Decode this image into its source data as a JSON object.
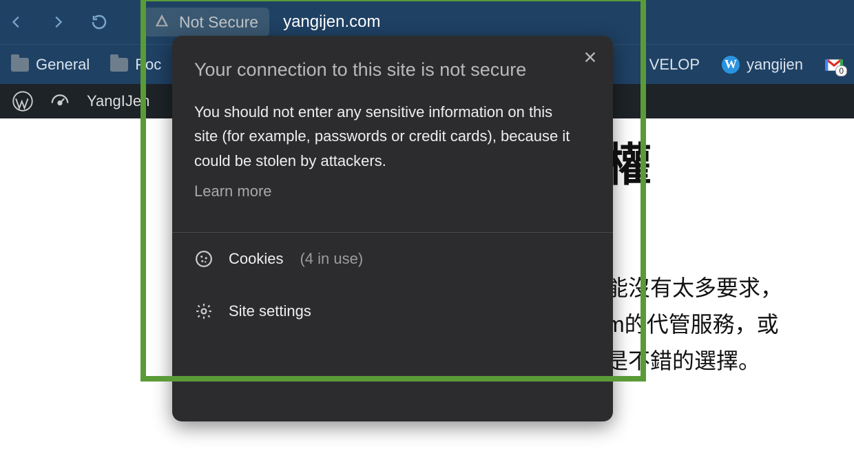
{
  "browser": {
    "not_secure_label": "Not Secure",
    "domain": "yangijen.com"
  },
  "bookmarks": {
    "general": "General",
    "pocket_partial": "Poc",
    "develop_partial": "VELOP",
    "yangijen": "yangijen",
    "gmail_badge": "0"
  },
  "wpbar": {
    "site_name": "YangIJen"
  },
  "page": {
    "title_partial": "權",
    "line1": "能沒有太多要求，",
    "line2": "m的代管服務，或",
    "line3": "是不錯的選擇。"
  },
  "popup": {
    "title": "Your connection to this site is not secure",
    "body": "You should not enter any sensitive information on this site (for example, passwords or credit cards), because it could be stolen by attackers.",
    "learn_more": "Learn more",
    "cookies_label": "Cookies",
    "cookies_count": "(4 in use)",
    "site_settings": "Site settings"
  }
}
